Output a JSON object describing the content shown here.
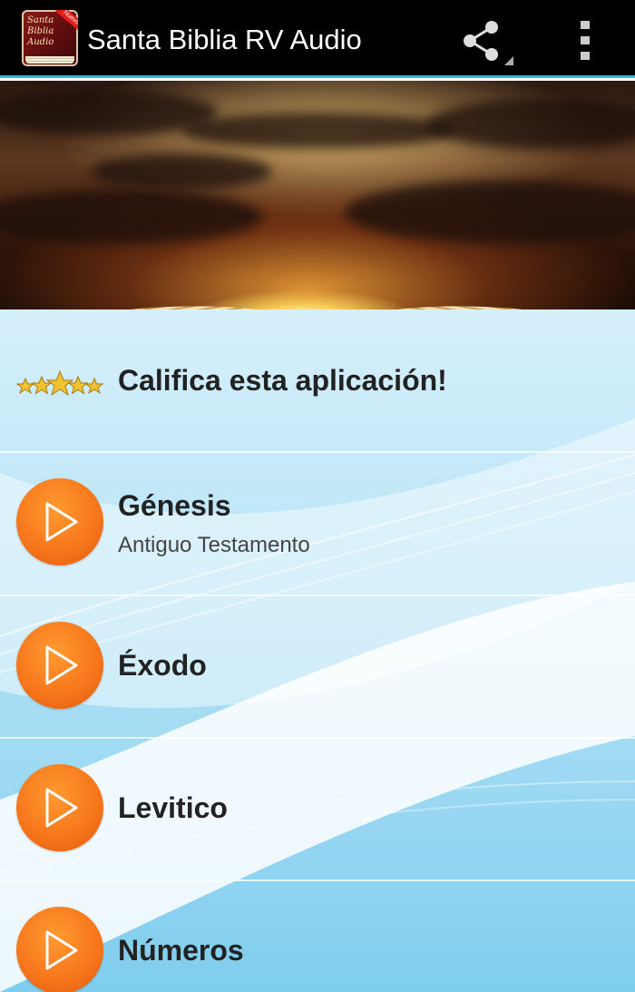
{
  "app": {
    "title": "Santa Biblia RV Audio",
    "icon_label": "Santa Biblia Audio",
    "icon_badge": "Nuevo"
  },
  "actions": {
    "share_icon": "share-icon",
    "overflow_icon": "overflow-menu-icon"
  },
  "banner": {
    "description_icon": "bible-sunrise-banner"
  },
  "rate_row": {
    "label": "Califica esta aplicación!",
    "icon": "five-stars-icon"
  },
  "books": [
    {
      "title": "Génesis",
      "subtitle": "Antiguo Testamento",
      "icon": "play-icon"
    },
    {
      "title": "Éxodo",
      "subtitle": "",
      "icon": "play-icon"
    },
    {
      "title": "Levitico",
      "subtitle": "",
      "icon": "play-icon"
    },
    {
      "title": "Números",
      "subtitle": "",
      "icon": "play-icon"
    }
  ],
  "colors": {
    "actionbar": "#000000",
    "accent": "#33b5e5",
    "play_button": "#f7781c",
    "list_background": "#b8e4f7",
    "stars": "#f2c230"
  }
}
